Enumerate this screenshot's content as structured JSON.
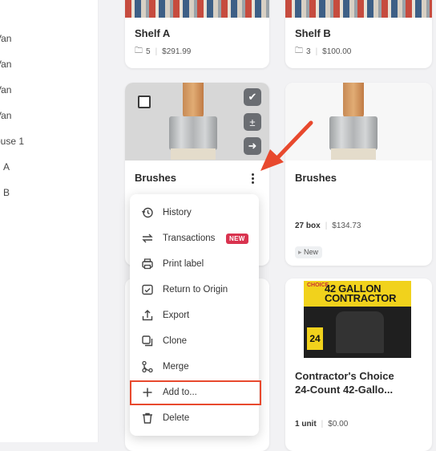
{
  "sidebar": {
    "items": [
      {
        "label": "Van"
      },
      {
        "label": "Van"
      },
      {
        "label": "Van"
      },
      {
        "label": "Van"
      },
      {
        "label": "ouse 1"
      },
      {
        "label": "A"
      },
      {
        "label": "B"
      }
    ]
  },
  "cards": [
    {
      "title": "Shelf A",
      "folders": "5",
      "price": "$291.99"
    },
    {
      "title": "Shelf B",
      "folders": "3",
      "price": "$100.00"
    },
    {
      "title": "Brushes"
    },
    {
      "title": "Brushes",
      "quantity": "27 box",
      "price": "$134.73",
      "tag": "New"
    },
    {
      "title_line1": "Contractor's Choice",
      "title_line2": "24-Count 42-Gallo...",
      "quantity": "1 unit",
      "price": "$0.00",
      "image_text": {
        "brand": "CHOICE",
        "big1": "42 GALLON",
        "big2": "CONTRACTOR",
        "count": "24"
      }
    }
  ],
  "context_menu": {
    "items": [
      {
        "label": "History",
        "icon": "history-icon"
      },
      {
        "label": "Transactions",
        "icon": "transactions-icon",
        "badge": "NEW"
      },
      {
        "label": "Print label",
        "icon": "printer-icon"
      },
      {
        "label": "Return to Origin",
        "icon": "return-icon"
      },
      {
        "label": "Export",
        "icon": "export-icon"
      },
      {
        "label": "Clone",
        "icon": "clone-icon"
      },
      {
        "label": "Merge",
        "icon": "merge-icon"
      },
      {
        "label": "Add to...",
        "icon": "plus-icon",
        "highlighted": true
      },
      {
        "label": "Delete",
        "icon": "trash-icon"
      }
    ]
  },
  "colors": {
    "accent_red": "#e8492e",
    "badge": "#d9334f"
  }
}
